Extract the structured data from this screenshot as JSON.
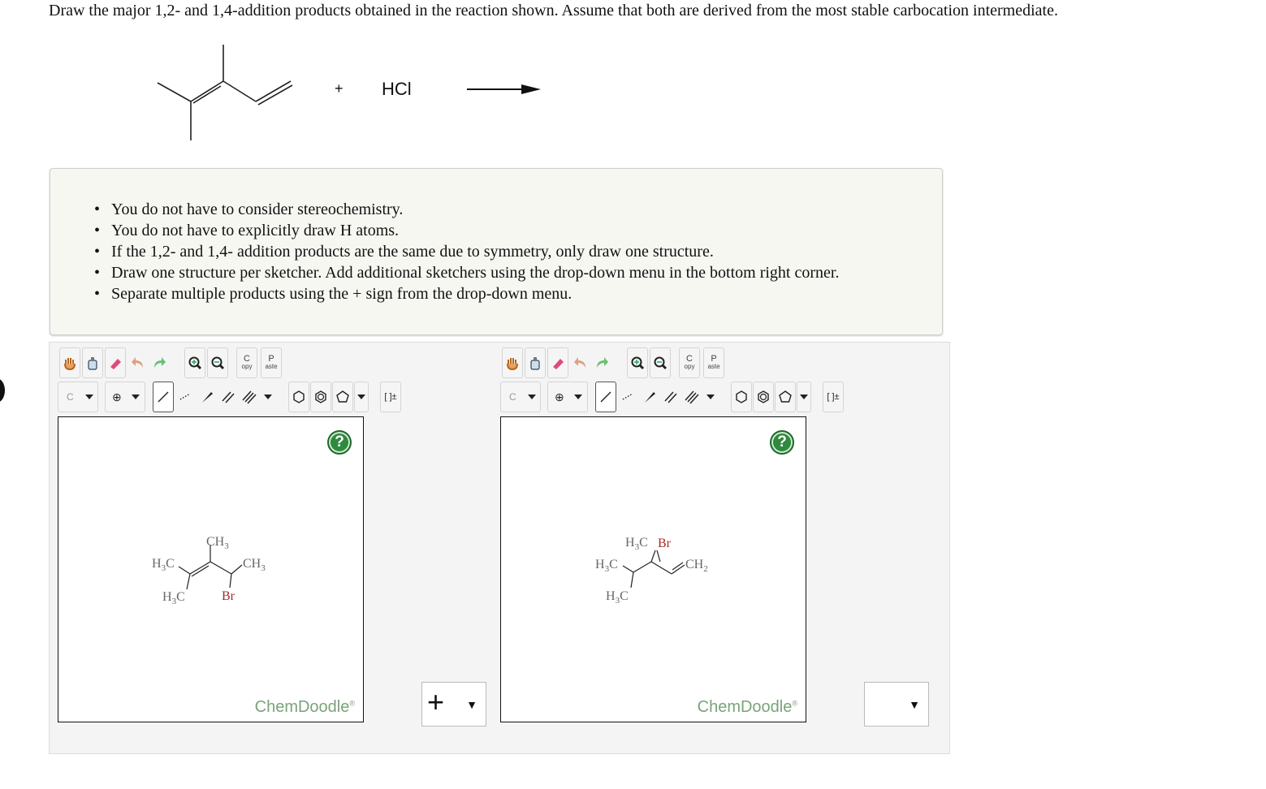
{
  "question": "Draw the major 1,2- and 1,4-addition products obtained in the reaction shown. Assume that both are derived from the most stable carbocation intermediate.",
  "reaction": {
    "plus": "+",
    "reagent": "HCl"
  },
  "instructions": [
    "You do not have to consider stereochemistry.",
    "You do not have to explicitly draw H atoms.",
    "If the 1,2- and 1,4- addition products are the same due to symmetry, only draw one structure.",
    "Draw one structure per sketcher. Add additional sketchers using the drop-down menu in the bottom right corner.",
    "Separate multiple products using the + sign from the drop-down menu."
  ],
  "toolbar": {
    "row1": [
      "hand-icon",
      "clear-icon",
      "eraser-icon",
      "undo-icon",
      "redo-icon",
      "zoom-in-icon",
      "zoom-out-icon",
      "copy-button",
      "paste-button"
    ],
    "copy_label_top": "C",
    "copy_label_bottom": "opy",
    "paste_label_top": "P",
    "paste_label_bottom": "aste",
    "atom_label": "C",
    "charge_label": "⊕",
    "bracket_label": "[ ]±"
  },
  "sketchers": [
    {
      "help": "?",
      "brand": "ChemDoodle",
      "brand_mark": "®",
      "labels": {
        "ch3_top": "CH",
        "ch3_top_sub": "3",
        "h3c_left": "H",
        "h3c_left_sub": "3",
        "h3c_left_c": "C",
        "ch3_right": "CH",
        "ch3_right_sub": "3",
        "h3c_bottom": "H",
        "h3c_bottom_sub": "3",
        "h3c_bottom_c": "C",
        "br": "Br"
      }
    },
    {
      "help": "?",
      "brand": "ChemDoodle",
      "brand_mark": "®",
      "labels": {
        "h3c_top": "H",
        "h3c_top_sub": "3",
        "h3c_top_c": "C",
        "br": "Br",
        "h3c_left": "H",
        "h3c_left_sub": "3",
        "h3c_left_c": "C",
        "ch2": "CH",
        "ch2_sub": "2",
        "h3c_bottom": "H",
        "h3c_bottom_sub": "3",
        "h3c_bottom_c": "C"
      }
    }
  ],
  "separators": [
    {
      "value": "+",
      "arrow": "▼"
    },
    {
      "value": "",
      "arrow": "▼"
    }
  ],
  "colors": {
    "accent_green": "#2d8a3e",
    "brand_green": "#7aa37a",
    "bromine_red": "#a52a2a"
  }
}
